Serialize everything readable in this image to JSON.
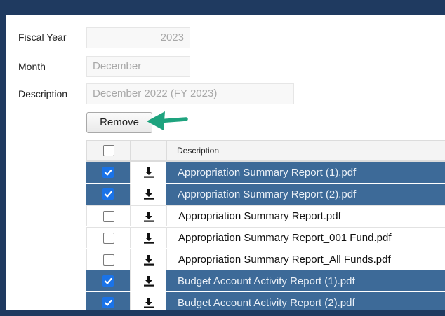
{
  "form": {
    "fiscal_year": {
      "label": "Fiscal Year",
      "value": "2023"
    },
    "month": {
      "label": "Month",
      "value": "December"
    },
    "description": {
      "label": "Description",
      "value": "December 2022 (FY 2023)"
    }
  },
  "remove_button": {
    "label": "Remove"
  },
  "grid": {
    "header": {
      "description": "Description",
      "select_all_checked": false
    },
    "rows": [
      {
        "name": "Appropriation Summary Report (1).pdf",
        "checked": true
      },
      {
        "name": "Appropriation Summary Report (2).pdf",
        "checked": true
      },
      {
        "name": "Appropriation Summary Report.pdf",
        "checked": false
      },
      {
        "name": "Appropriation Summary Report_001 Fund.pdf",
        "checked": false
      },
      {
        "name": "Appropriation Summary Report_All Funds.pdf",
        "checked": false
      },
      {
        "name": "Budget Account Activity Report (1).pdf",
        "checked": true
      },
      {
        "name": "Budget Account Activity Report (2).pdf",
        "checked": true
      }
    ]
  },
  "colors": {
    "frame": "#1f3a60",
    "selected_row": "#3d6a98",
    "checkbox_checked": "#1a73e8",
    "arrow": "#1ea37e"
  },
  "icons": {
    "download": "download-icon",
    "check": "checkmark-icon",
    "annotation": "green-arrow-icon"
  }
}
